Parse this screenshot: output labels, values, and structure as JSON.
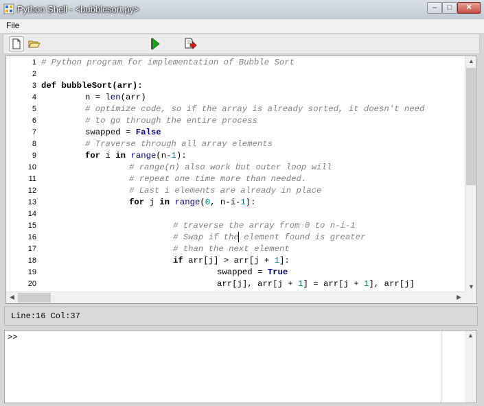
{
  "window": {
    "title": "Python Shell - <bubblesort.py>",
    "min_symbol": "‒",
    "max_symbol": "□",
    "close_symbol": "✕"
  },
  "menu": {
    "file_label": "File"
  },
  "toolbar": {
    "buttons": [
      "new-file-icon",
      "open-folder-icon",
      "run-icon",
      "stop-icon"
    ]
  },
  "editor": {
    "lines": [
      {
        "n": "1"
      },
      {
        "n": "2"
      },
      {
        "n": "3"
      },
      {
        "n": "4"
      },
      {
        "n": "5"
      },
      {
        "n": "6"
      },
      {
        "n": "7"
      },
      {
        "n": "8"
      },
      {
        "n": "9"
      },
      {
        "n": "10"
      },
      {
        "n": "11"
      },
      {
        "n": "12"
      },
      {
        "n": "13"
      },
      {
        "n": "14"
      },
      {
        "n": "15"
      },
      {
        "n": "16"
      },
      {
        "n": "17"
      },
      {
        "n": "18"
      },
      {
        "n": "19"
      },
      {
        "n": "20"
      }
    ],
    "code": {
      "l1": "# Python program for implementation of Bubble Sort",
      "l3_kw": "def",
      "l3_rest": " bubbleSort(arr):",
      "l4_a": "n = ",
      "l4_bi": "len",
      "l4_b": "(arr)",
      "l5": "# optimize code, so if the array is already sorted, it doesn't need",
      "l6": "# to go through the entire process",
      "l7_a": "swapped = ",
      "l7_kc": "False",
      "l8": "# Traverse through all array elements",
      "l9_kw1": "for",
      "l9_a": " i ",
      "l9_kw2": "in",
      "l9_sp": " ",
      "l9_bi": "range",
      "l9_b": "(n-",
      "l9_num": "1",
      "l9_c": "):",
      "l10": "# range(n) also work but outer loop will",
      "l11": "# repeat one time more than needed.",
      "l12": "# Last i elements are already in place",
      "l13_kw1": "for",
      "l13_a": " j ",
      "l13_kw2": "in",
      "l13_sp": " ",
      "l13_bi": "range",
      "l13_b": "(",
      "l13_num1": "0",
      "l13_c": ", n-i-",
      "l13_num2": "1",
      "l13_d": "):",
      "l15": "# traverse the array from 0 to n-i-1",
      "l16": "# Swap if the element found is greater",
      "l17": "# than the next element",
      "l18_kw": "if",
      "l18_a": " arr[j] > arr[j + ",
      "l18_num": "1",
      "l18_b": "]:",
      "l19_a": "swapped = ",
      "l19_kc": "True",
      "l20_a": "arr[j], arr[j + ",
      "l20_num1": "1",
      "l20_b": "] = arr[j + ",
      "l20_num2": "1",
      "l20_c": "], arr[j]"
    }
  },
  "status": {
    "position": "Line:16 Col:37"
  },
  "shell": {
    "prompt": ">>"
  },
  "colors": {
    "comment": "#808080",
    "builtin": "#00007f",
    "number": "#007f7f",
    "run_green": "#1aa31a",
    "stop_red": "#d42020"
  }
}
